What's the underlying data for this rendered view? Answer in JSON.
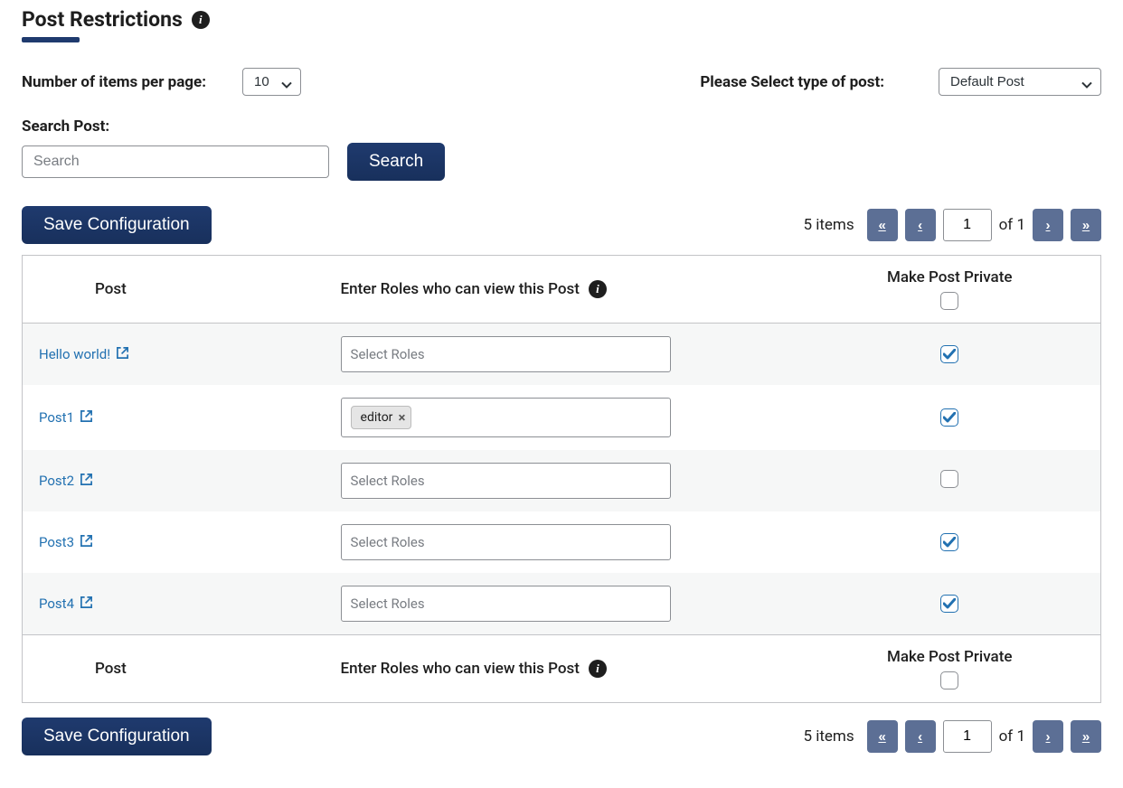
{
  "title": "Post Restrictions",
  "labels": {
    "items_per_page": "Number of items per page:",
    "select_post_type": "Please Select type of post:",
    "search_post": "Search Post:"
  },
  "items_per_page": {
    "value": "10"
  },
  "post_type_select": {
    "value": "Default Post"
  },
  "search": {
    "placeholder": "Search",
    "button": "Search"
  },
  "buttons": {
    "save_config": "Save Configuration"
  },
  "pagination": {
    "items_text": "5 items",
    "current": "1",
    "total": "1",
    "of": "of"
  },
  "table": {
    "headers": {
      "post": "Post",
      "roles": "Enter Roles who can view this Post",
      "private": "Make Post Private"
    },
    "role_placeholder": "Select Roles",
    "rows": [
      {
        "title": "Hello world!",
        "roles": [],
        "private": true
      },
      {
        "title": "Post1",
        "roles": [
          "editor"
        ],
        "private": true
      },
      {
        "title": "Post2",
        "roles": [],
        "private": false
      },
      {
        "title": "Post3",
        "roles": [],
        "private": true
      },
      {
        "title": "Post4",
        "roles": [],
        "private": true
      }
    ]
  }
}
